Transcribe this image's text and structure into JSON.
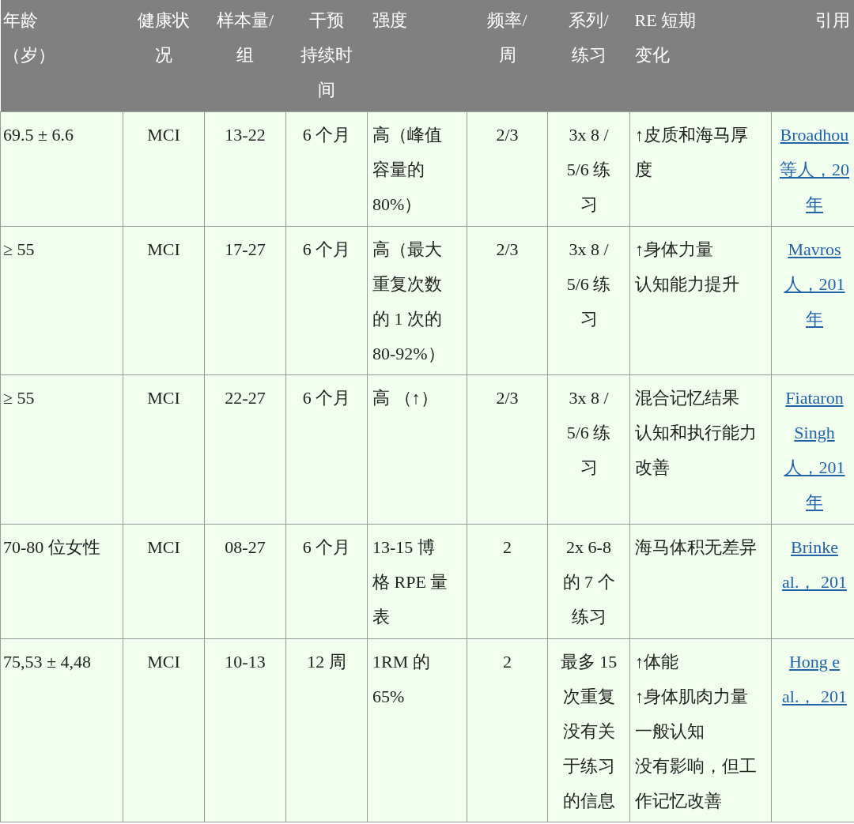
{
  "table": {
    "columns": [
      {
        "lines": [
          "年龄",
          "（岁）"
        ]
      },
      {
        "lines": [
          "健康状",
          "况"
        ]
      },
      {
        "lines": [
          "样本量/",
          "组"
        ]
      },
      {
        "lines": [
          "干预",
          "持续时",
          "间"
        ]
      },
      {
        "lines": [
          "强度"
        ]
      },
      {
        "lines": [
          "频率/",
          "周"
        ]
      },
      {
        "lines": [
          "系列/",
          "练习"
        ]
      },
      {
        "lines": [
          "RE 短期",
          "变化"
        ]
      },
      {
        "lines": [
          "引用"
        ]
      }
    ],
    "rows": [
      {
        "cells": [
          [
            "69.5 ± 6.6"
          ],
          [
            "MCI"
          ],
          [
            "13-22"
          ],
          [
            "6 个月"
          ],
          [
            "高（峰值",
            "容量的",
            "80%）"
          ],
          [
            "2/3"
          ],
          [
            "3x 8 /",
            "5/6 练",
            "习"
          ],
          [
            "↑皮质和海马厚",
            "度"
          ]
        ],
        "citation": [
          "Broadhou",
          "等人，20",
          "年"
        ]
      },
      {
        "cells": [
          [
            "≥ 55"
          ],
          [
            "MCI"
          ],
          [
            "17-27"
          ],
          [
            "6 个月"
          ],
          [
            "高（最大",
            "重复次数",
            "的 1 次的",
            "80-92%）"
          ],
          [
            "2/3"
          ],
          [
            "3x 8 /",
            "5/6 练",
            "习"
          ],
          [
            "↑身体力量",
            "认知能力提升"
          ]
        ],
        "citation": [
          "Mavros",
          "人，201",
          "年"
        ]
      },
      {
        "cells": [
          [
            "≥ 55"
          ],
          [
            "MCI"
          ],
          [
            "22-27"
          ],
          [
            "6 个月"
          ],
          [
            "高 （↑）"
          ],
          [
            "2/3"
          ],
          [
            "3x 8 /",
            "5/6 练",
            "习"
          ],
          [
            "混合记忆结果",
            "认知和执行能力",
            "改善"
          ]
        ],
        "citation": [
          "Fiataron",
          "Singh",
          "人，201",
          "年"
        ]
      },
      {
        "cells": [
          [
            "70-80 位女性"
          ],
          [
            "MCI"
          ],
          [
            "08-27"
          ],
          [
            "6 个月"
          ],
          [
            "13-15 博",
            "格 RPE 量",
            "表"
          ],
          [
            "2"
          ],
          [
            "2x 6-8",
            "的 7 个",
            "练习"
          ],
          [
            "海马体积无差异"
          ]
        ],
        "citation": [
          "Brinke",
          "al.， 201"
        ]
      },
      {
        "cells": [
          [
            "75,53 ± 4,48"
          ],
          [
            "MCI"
          ],
          [
            "10-13"
          ],
          [
            "12 周"
          ],
          [
            "1RM 的",
            "65%"
          ],
          [
            "2"
          ],
          [
            "最多 15",
            "次重复",
            "没有关",
            "于练习",
            "的信息"
          ],
          [
            "↑体能",
            "↑身体肌肉力量",
            "一般认知",
            "没有影响，但工",
            "作记忆改善"
          ]
        ],
        "citation": [
          "Hong e",
          "al.， 201"
        ]
      }
    ]
  }
}
